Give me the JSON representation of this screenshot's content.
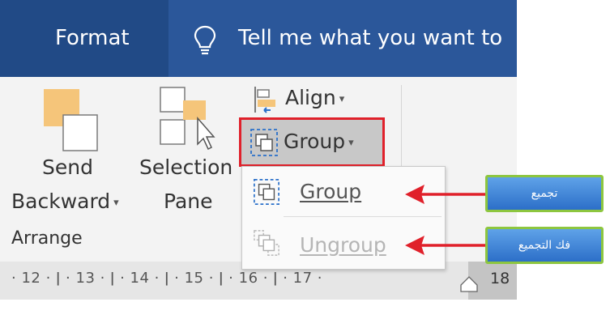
{
  "topbar": {
    "tab_format": "Format",
    "tell_me": "Tell me what you want to",
    "icons": [
      "lightbulb-icon"
    ]
  },
  "ribbon": {
    "send_backward": {
      "line1": "Send",
      "line2": "Backward",
      "caret": "▾",
      "icon": "send-backward-icon"
    },
    "selection_pane": {
      "line1": "Selection",
      "line2": "Pane",
      "icon": "selection-pane-icon"
    },
    "align": {
      "label": "Align",
      "caret": "▾",
      "icon": "align-icon"
    },
    "group": {
      "label": "Group",
      "caret": "▾",
      "icon": "group-icon"
    },
    "group_name": "Arrange"
  },
  "dropdown": {
    "items": [
      {
        "label": "Group",
        "enabled": true,
        "icon": "group-icon"
      },
      {
        "label": "Ungroup",
        "enabled": false,
        "icon": "ungroup-icon"
      }
    ]
  },
  "ruler": {
    "text": "· 12 · ǀ · 13 · ǀ · 14 · ǀ · 15 · ǀ · 16 · ǀ · 17 ·",
    "end_number": "18"
  },
  "callouts": [
    {
      "label": "تجميع"
    },
    {
      "label": "فك التجميع"
    }
  ],
  "colors": {
    "topbar": "#2b579a",
    "format_tab": "#214a86",
    "ribbon": "#f3f3f3",
    "highlight_box": "#e0202a",
    "arrow": "#e0202a",
    "callout_border": "#8dc63f",
    "callout_fill": "#3a7fd5"
  }
}
